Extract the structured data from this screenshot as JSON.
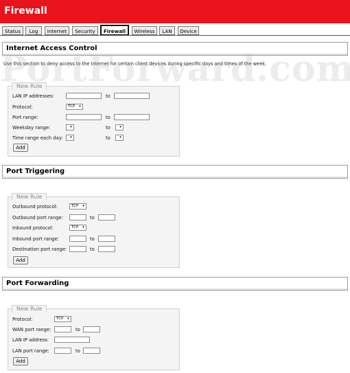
{
  "header": {
    "title": "Firewall"
  },
  "tabs": [
    "Status",
    "Log",
    "Internet",
    "Security",
    "Firewall",
    "Wireless",
    "LAN",
    "Device"
  ],
  "active_tab": "Firewall",
  "watermark": "PortForward.com",
  "iac": {
    "heading": "Internet Access Control",
    "description": "Use this section to deny access to the Internet for certain client devices during specific days and times of the week.",
    "legend": "New Rule",
    "lan_ip_label": "LAN IP addresses:",
    "protocol_label": "Protocol:",
    "protocol_value": "TCP",
    "port_range_label": "Port range:",
    "weekday_label": "Weekday range:",
    "time_label": "Time range each day:",
    "to": "to",
    "add": "Add"
  },
  "pt": {
    "heading": "Port Triggering",
    "legend": "New Rule",
    "out_proto_label": "Outbound protocol:",
    "out_proto_value": "TCP",
    "out_range_label": "Outbound port range:",
    "in_proto_label": "Inbound protocol:",
    "in_proto_value": "TCP",
    "in_range_label": "Inbound port range:",
    "dest_range_label": "Destination port range:",
    "to": "to",
    "add": "Add"
  },
  "pf": {
    "heading": "Port Forwarding",
    "legend": "New Rule",
    "protocol_label": "Protocol:",
    "protocol_value": "TCP",
    "wan_range_label": "WAN port range:",
    "lan_ip_label": "LAN IP address:",
    "lan_range_label": "LAN port range:",
    "to": "to",
    "add": "Add"
  },
  "icons": {
    "dropdown": "chevron-down-icon"
  }
}
